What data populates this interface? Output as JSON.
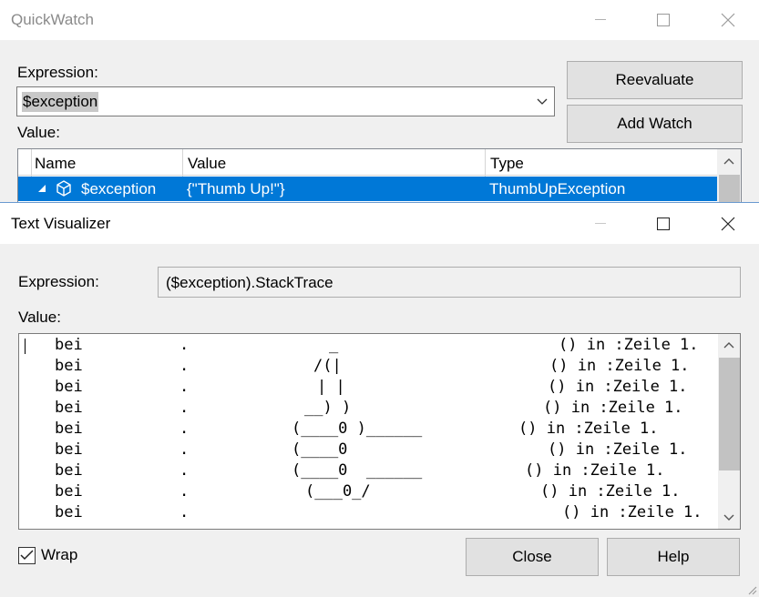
{
  "quickwatch": {
    "title": "QuickWatch",
    "expression_label": "Expression:",
    "expression_value": "$exception",
    "reevaluate_label": "Reevaluate",
    "add_watch_label": "Add Watch",
    "value_label": "Value:",
    "columns": {
      "name": "Name",
      "value": "Value",
      "type": "Type"
    },
    "row": {
      "name": "$exception",
      "value": "{\"Thumb Up!\"}",
      "type": "ThumbUpException"
    }
  },
  "text_visualizer": {
    "title": "Text Visualizer",
    "expression_label": "Expression:",
    "expression_value": "($exception).StackTrace",
    "value_label": "Value:",
    "stack_lines": [
      {
        "bei": "bei",
        "dot": ".",
        "art": "_",
        "tail": "() in :Zeile 1."
      },
      {
        "bei": "bei",
        "dot": ".",
        "art": "/(|",
        "tail": "() in :Zeile 1."
      },
      {
        "bei": "bei",
        "dot": ".",
        "art": "| |",
        "tail": "() in :Zeile 1."
      },
      {
        "bei": "bei",
        "dot": ".",
        "art": "__) )",
        "tail": "() in :Zeile 1."
      },
      {
        "bei": "bei",
        "dot": ".",
        "art": "(____0 )______",
        "tail": "() in :Zeile 1."
      },
      {
        "bei": "bei",
        "dot": ".",
        "art": "(____0",
        "tail": "() in :Zeile 1."
      },
      {
        "bei": "bei",
        "dot": ".",
        "art": "(____0  ______",
        "tail": "() in :Zeile 1."
      },
      {
        "bei": "bei",
        "dot": ".",
        "art": "(___0_/",
        "tail": "() in :Zeile 1."
      },
      {
        "bei": "bei",
        "dot": ".",
        "art": "",
        "tail": "() in :Zeile 1."
      }
    ],
    "wrap_label": "Wrap",
    "wrap_checked": true,
    "close_label": "Close",
    "help_label": "Help"
  },
  "colors": {
    "selection": "#0078d7",
    "button_face": "#e1e1e1",
    "window_bg": "#f0f0f0"
  }
}
